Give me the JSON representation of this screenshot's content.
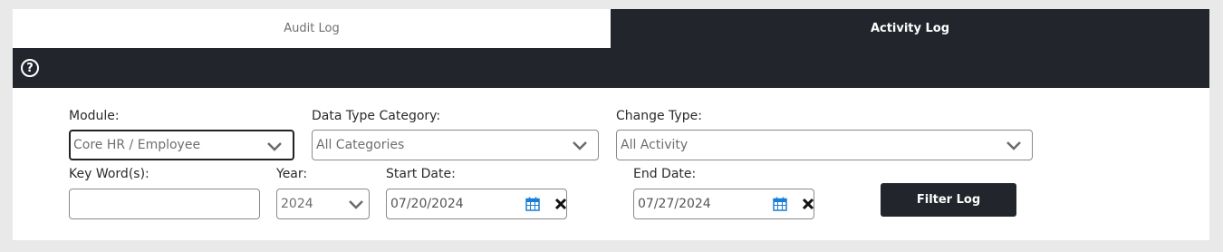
{
  "tabs": {
    "audit_log": "Audit Log",
    "activity_log": "Activity Log"
  },
  "toolbar": {
    "help_glyph": "?"
  },
  "filters": {
    "module": {
      "label": "Module:",
      "value": "Core HR / Employee"
    },
    "data_type_category": {
      "label": "Data Type Category:",
      "value": "All Categories"
    },
    "change_type": {
      "label": "Change Type:",
      "value": "All Activity"
    },
    "keywords": {
      "label": "Key Word(s):",
      "value": ""
    },
    "year": {
      "label": "Year:",
      "value": "2024"
    },
    "start_date": {
      "label": "Start Date:",
      "value": "07/20/2024"
    },
    "end_date": {
      "label": "End Date:",
      "value": "07/27/2024"
    }
  },
  "actions": {
    "filter_log": "Filter Log"
  },
  "colors": {
    "dark": "#22252b",
    "calendar_accent": "#1a7fd4",
    "page_bg": "#e9e9e9"
  }
}
